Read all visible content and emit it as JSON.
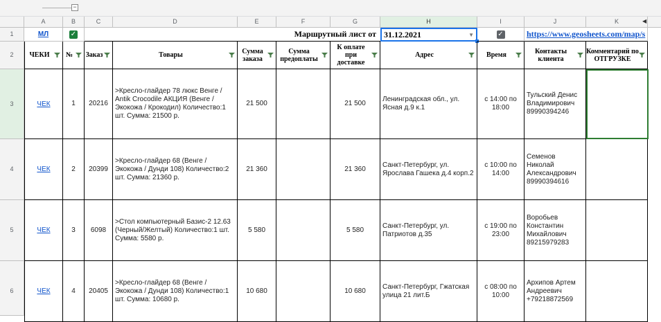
{
  "columns": [
    "A",
    "B",
    "C",
    "D",
    "E",
    "F",
    "G",
    "H",
    "I",
    "J",
    "K"
  ],
  "row_numbers": [
    "1",
    "2",
    "3",
    "4",
    "5",
    "6"
  ],
  "toolbar": {
    "collapse_symbol": "−"
  },
  "row1": {
    "ml_link": "МЛ",
    "title": "Маршрутный лист от",
    "date": "31.12.2021",
    "url": "https://www.geosheets.com/map/s"
  },
  "headers": {
    "checks": "ЧЕКИ",
    "num": "№",
    "order": "Заказ",
    "goods": "Товары",
    "order_sum": "Сумма заказа",
    "prepay_sum": "Сумма предоплаты",
    "to_pay": "К оплате при доставке",
    "address": "Адрес",
    "time": "Время",
    "contacts": "Контакты клиента",
    "comment": "Комментарий по ОТГРУЗКЕ"
  },
  "rows": [
    {
      "check": "ЧЕК",
      "num": "1",
      "order": "20216",
      "goods": ">Кресло-глайдер 78 люкс Венге / Antik Crocodile АКЦИЯ (Венге / Экокожа / Крокодил) Количество:1 шт. Сумма: 21500 р.",
      "order_sum": "21 500",
      "prepay_sum": "",
      "to_pay": "21 500",
      "address": "Ленинградская обл., ул. Ясная д.9 к.1",
      "time": "с 14:00 по 18:00",
      "contacts": "Тульский Денис Владимирович 89990394246",
      "comment": ""
    },
    {
      "check": "ЧЕК",
      "num": "2",
      "order": "20399",
      "goods": ">Кресло-глайдер 68 (Венге / Экокожа / Дунди 108) Количество:2 шт. Сумма: 21360 р.",
      "order_sum": "21 360",
      "prepay_sum": "",
      "to_pay": "21 360",
      "address": "Санкт-Петербург, ул. Ярослава Гашека д.4 корп.2",
      "time": "с 10:00 по 14:00",
      "contacts": "Семенов Николай Александрович 89990394616",
      "comment": ""
    },
    {
      "check": "ЧЕК",
      "num": "3",
      "order": "6098",
      "goods": ">Стол компьютерный Базис-2 12.63 (Черный/Желтый) Количество:1 шт. Сумма: 5580 р.",
      "order_sum": "5 580",
      "prepay_sum": "",
      "to_pay": "5 580",
      "address": "Санкт-Петербург, ул. Патриотов д.35",
      "time": "с 19:00 по 23:00",
      "contacts": "Воробьев Константин Михайлович 89215979283",
      "comment": ""
    },
    {
      "check": "ЧЕК",
      "num": "4",
      "order": "20405",
      "goods": ">Кресло-глайдер 68 (Венге / Экокожа / Дунди 108) Количество:1 шт. Сумма: 10680 р.",
      "order_sum": "10 680",
      "prepay_sum": "",
      "to_pay": "10 680",
      "address": "Санкт-Петербург, Гжатская улица 21 лит.Б",
      "time": "с 08:00 по 10:00",
      "contacts": "Архипов Артем Андреевич +79218872569",
      "comment": ""
    }
  ]
}
